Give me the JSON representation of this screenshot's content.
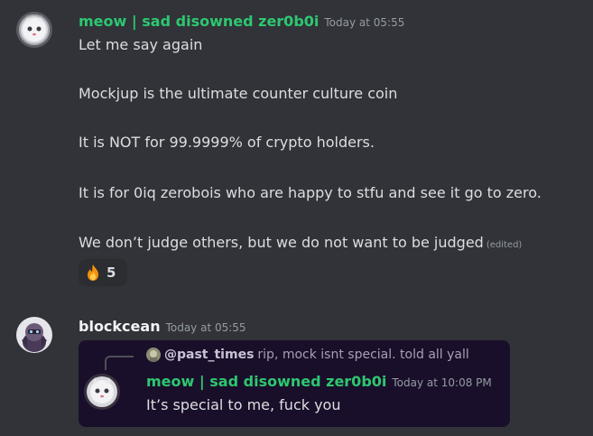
{
  "messages": [
    {
      "author": "meow | sad disowned zer0b0i",
      "author_color": "#2dc770",
      "timestamp": "Today at 05:55",
      "lines": [
        "Let me say again",
        "Mockjup is the ultimate counter culture coin",
        "It is NOT for 99.9999% of crypto holders.",
        "It is for 0iq zerobois who are happy to stfu and see it go to zero.",
        "We don’t judge others, but we do not want to be judged"
      ],
      "edited_label": "(edited)",
      "reaction": {
        "icon": "fire-icon",
        "count": "5"
      }
    },
    {
      "author": "blockcean",
      "author_color": "#f2f3f5",
      "timestamp": "Today at 05:55",
      "embed": {
        "reply": {
          "user": "@past_times",
          "text": "rip, mock isnt special. told all yall"
        },
        "author": "meow | sad disowned zer0b0i",
        "author_color": "#2dc770",
        "timestamp": "Today at 10:08 PM",
        "text": "It’s special to me, fuck you"
      }
    }
  ]
}
